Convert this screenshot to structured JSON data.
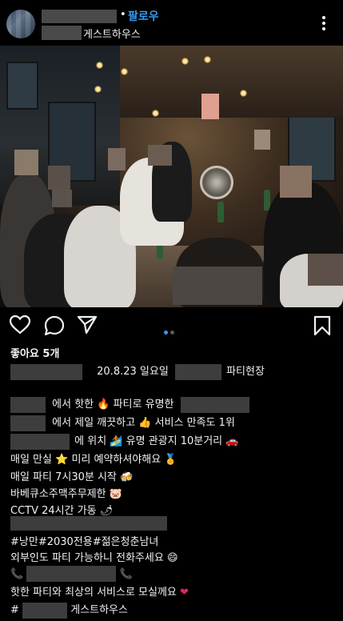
{
  "header": {
    "separator_dot": "•",
    "follow_label": "팔로우",
    "location_suffix": "게스트하우스",
    "more_icon": "more-vertical-icon"
  },
  "actions": {
    "like_icon": "heart-outline-icon",
    "comment_icon": "comment-icon",
    "share_icon": "paper-plane-icon",
    "save_icon": "bookmark-icon",
    "carousel_active_color": "#3897f0",
    "carousel_inactive_color": "#5a5a5a"
  },
  "likes": "좋아요 5개",
  "caption": {
    "line1_mid": "20.8.23 일요일",
    "line1_end": "파티현장",
    "line2_a": "에서 핫한",
    "line2_b": "파티로 유명한",
    "line3_a": "에서 제일 깨끗하고",
    "line3_b": "서비스 만족도 1위",
    "line4_a": "에 위치",
    "line4_b": "유명 관광지 10분거리",
    "line5_a": "매일 만실",
    "line5_b": "미리 예약하셔야해요",
    "line6": "매일 파티 7시30분 시작",
    "line7": "바베큐소주맥주무제한",
    "line8": "CCTV 24시간 가동",
    "line9": "#낭만#2030전용#젊은청춘남녀",
    "line10": "외부인도 파티 가능하니 전화주세요",
    "line11_icon": "phone-icon",
    "line12": "핫한 파티와 최상의 서비스로 모실께요",
    "line13_prefix": "#",
    "line13_suffix": "게스트하우스"
  },
  "emojis": {
    "fire": "🔥",
    "thumb": "👍",
    "surfer": "🏄",
    "car": "🚗",
    "star": "⭐",
    "medal": "🏅",
    "beer": "🍻",
    "pig": "🐷",
    "pepper": "🌶",
    "smile": "😄",
    "heart": "❤",
    "phone": "📞"
  }
}
